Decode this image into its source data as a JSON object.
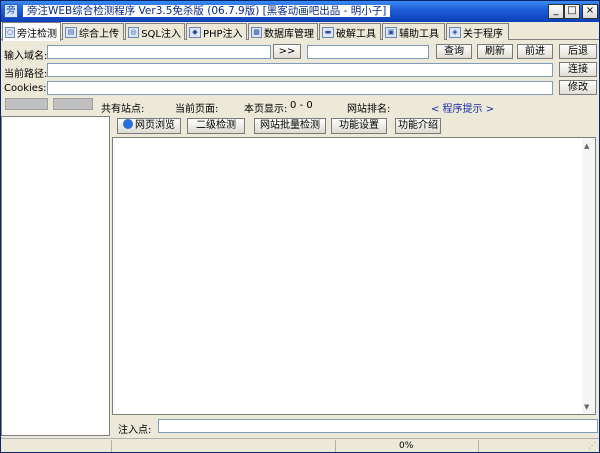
{
  "window": {
    "title": "旁注WEB综合检测程序 Ver3.5免杀版 (06.7.9版) [黑客动画吧出品 - 明小子]",
    "controls": {
      "minimize": "_",
      "maximize": "□",
      "close": "×"
    }
  },
  "tabs": [
    {
      "label": "旁注检测",
      "icon": "magnifier-icon",
      "active": true
    },
    {
      "label": "综合上传",
      "icon": "upload-icon"
    },
    {
      "label": "SQL注入",
      "icon": "search-icon"
    },
    {
      "label": "PHP注入",
      "icon": "php-icon"
    },
    {
      "label": "数据库管理",
      "icon": "database-icon"
    },
    {
      "label": "破解工具",
      "icon": "crack-icon"
    },
    {
      "label": "辅助工具",
      "icon": "tool-icon"
    },
    {
      "label": "关于程序",
      "icon": "info-icon"
    }
  ],
  "form": {
    "domain_label": "输入域名:",
    "domain_value": "",
    "go_button": ">>",
    "domain_result_value": "",
    "query_button": "查询",
    "refresh_button": "刷新",
    "forward_button": "前进",
    "back_button": "后退",
    "path_label": "当前路径:",
    "path_value": "",
    "connect_button": "连接",
    "cookies_label": "Cookies:",
    "cookies_value": "",
    "modify_button": "修改"
  },
  "info": {
    "sites_label": "共有站点:",
    "current_page_label": "当前页面:",
    "page_display_label": "本页显示:",
    "page_display_value": "0 - 0",
    "rank_label": "网站排名:",
    "program_tip": "< 程序提示 >"
  },
  "subtabs": {
    "browse": "网页浏览",
    "secondary": "二级检测",
    "batch": "网站批量检测",
    "settings": "功能设置",
    "intro": "功能介绍"
  },
  "inject": {
    "label": "注入点:",
    "value": ""
  },
  "status": {
    "progress": "0%"
  },
  "colors": {
    "title_bar": "#1f5fd8",
    "tip_text": "#1a2ca8"
  }
}
